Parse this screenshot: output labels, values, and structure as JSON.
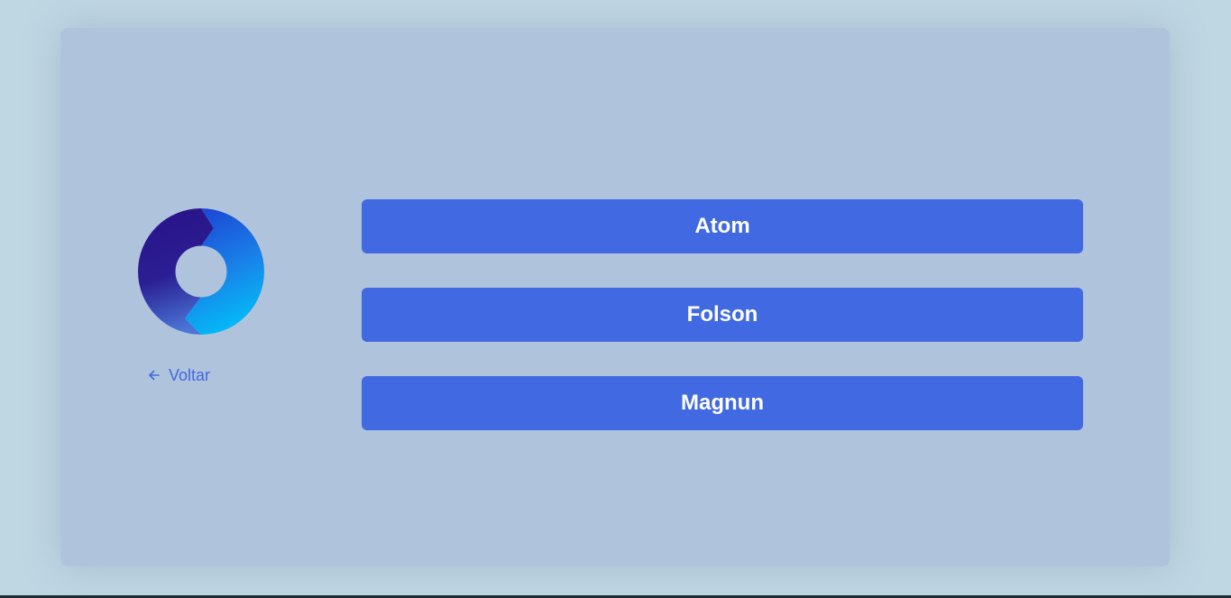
{
  "back": {
    "label": "Voltar",
    "icon": "arrow-left-icon"
  },
  "logo": {
    "icon": "ring-logo-icon",
    "colors": [
      "#2a1a8e",
      "#1e5ad6",
      "#00b4f5",
      "#3a5cc8"
    ]
  },
  "options": [
    {
      "label": "Atom"
    },
    {
      "label": "Folson"
    },
    {
      "label": "Magnun"
    }
  ],
  "colors": {
    "page_background": "#bfd6e3",
    "card_background": "#afc4dc",
    "accent": "#4169e1",
    "button_text": "#ffffff"
  }
}
